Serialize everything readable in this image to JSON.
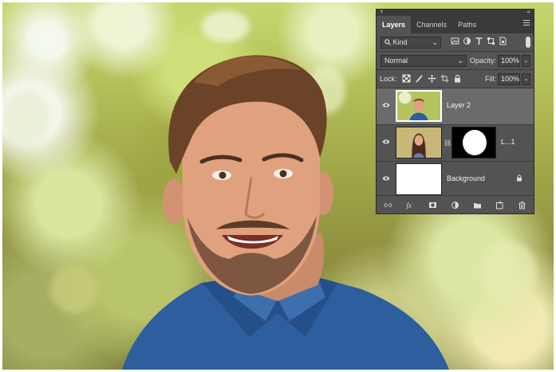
{
  "panel": {
    "close_glyph": "×",
    "collapse_glyph": "«",
    "tabs": [
      {
        "label": "Layers"
      },
      {
        "label": "Channels"
      },
      {
        "label": "Paths"
      }
    ],
    "filter": {
      "kind_label": "Kind",
      "icons": [
        "image-filter-icon",
        "adjustment-filter-icon",
        "type-filter-icon",
        "shape-filter-icon",
        "smart-object-filter-icon"
      ]
    },
    "blend": {
      "mode": "Normal",
      "opacity_label": "Opacity:",
      "opacity_value": "100%"
    },
    "lock": {
      "label": "Lock:",
      "fill_label": "Fill:",
      "fill_value": "100%",
      "icons": [
        "lock-transparent-icon",
        "lock-image-icon",
        "lock-position-icon",
        "lock-artboard-icon",
        "lock-all-icon"
      ]
    },
    "layers": [
      {
        "name": "Layer 2",
        "selected": true
      },
      {
        "name": "L...1",
        "has_mask": true
      },
      {
        "name": "Background",
        "locked": true
      }
    ],
    "bottom_icons": [
      "link-icon",
      "fx-icon",
      "mask-icon",
      "adjustment-icon",
      "folder-icon",
      "new-layer-icon",
      "trash-icon"
    ]
  },
  "colors": {
    "panel_bg": "#535353",
    "selected_row": "#6b6b6b",
    "tab_bar": "#3a3a3a"
  }
}
